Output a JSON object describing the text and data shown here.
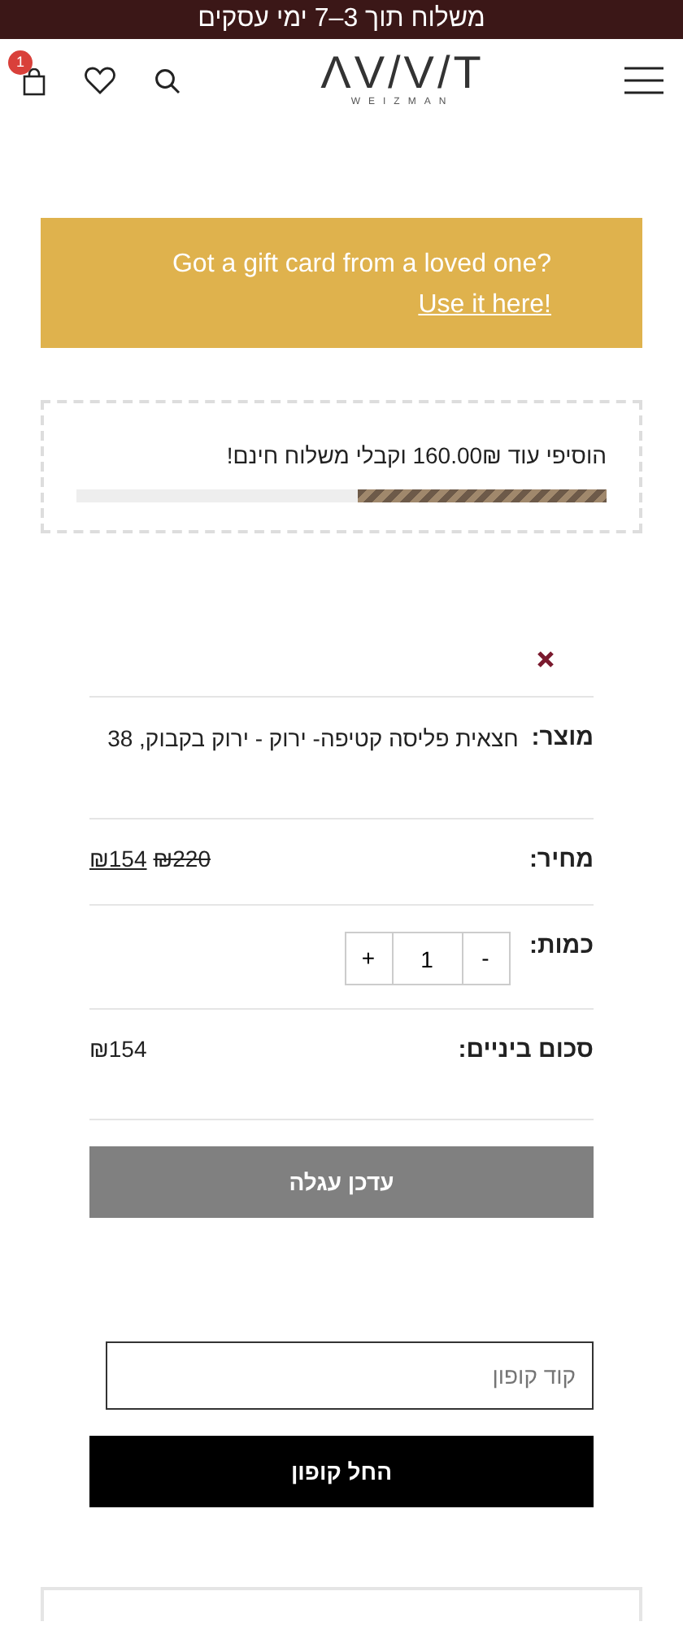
{
  "top_bar": {
    "text": "משלוח תוך 3–7 ימי עסקים"
  },
  "header": {
    "logo": "ΛV/V/T",
    "logo_subtitle": "WEIZMAN",
    "cart_count": "1"
  },
  "gift_banner": {
    "text": "Got a gift card from a loved one? ",
    "link": "Use it here!"
  },
  "shipping": {
    "text": "הוסיפי עוד 160.00₪ וקבלי משלוח חינם!",
    "level": 0.47
  },
  "cart_rows": [
    {
      "kind": "product",
      "label": "מוצר:",
      "value": "חצאית פליסה קטיפה- ירוק - ירוק בקבוק, 38"
    },
    {
      "kind": "price",
      "label": "מחיר:",
      "old_price": "₪220",
      "price": "₪154"
    },
    {
      "kind": "quantity",
      "label": "כמות:",
      "minus": "-",
      "value": "1",
      "plus": "+"
    },
    {
      "kind": "subtotal",
      "label": "סכום ביניים:",
      "value": "₪154"
    }
  ],
  "update_button": "עדכן עגלה",
  "coupon": {
    "placeholder": "קוד קופון",
    "button": "החל קופון"
  }
}
